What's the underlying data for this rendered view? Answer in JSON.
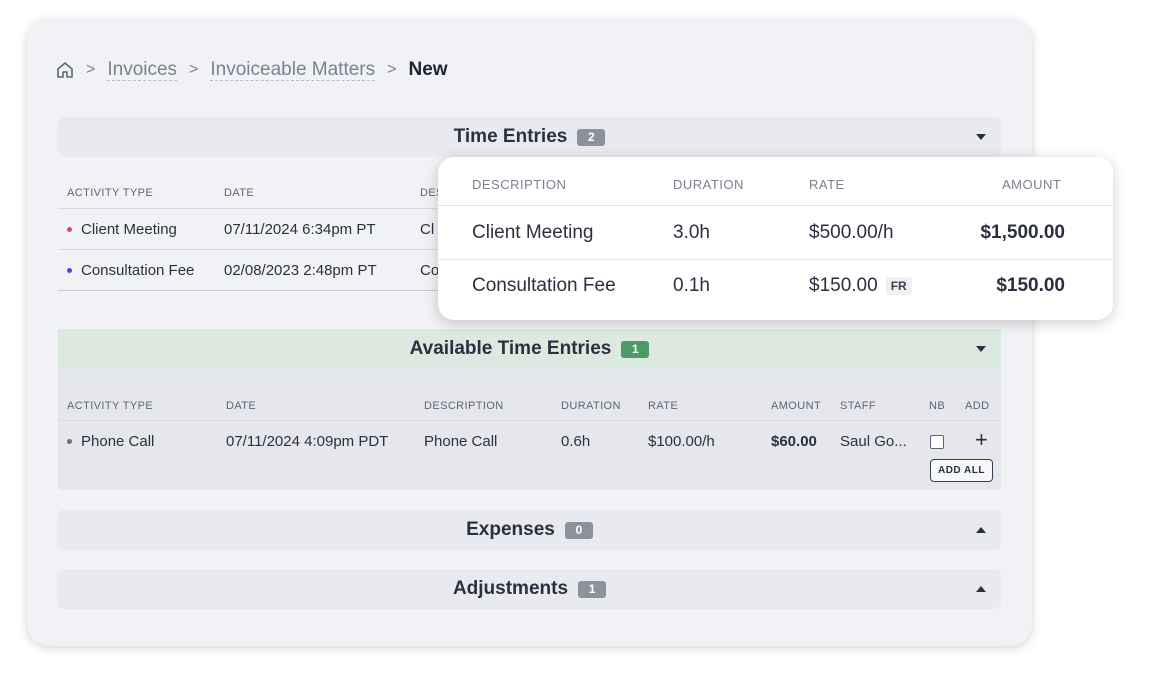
{
  "breadcrumb": {
    "items": [
      "Invoices",
      "Invoiceable Matters"
    ],
    "current": "New"
  },
  "time_entries": {
    "title": "Time Entries",
    "count": "2",
    "columns": [
      "ACTIVITY TYPE",
      "DATE",
      "DES"
    ],
    "rows": [
      {
        "activity": "Client Meeting",
        "date": "07/11/2024 6:34pm PT",
        "desc": "Cl",
        "dot_color": "#e0436b"
      },
      {
        "activity": "Consultation Fee",
        "date": "02/08/2023 2:48pm PT",
        "desc": "Co",
        "dot_color": "#5a3fd6"
      }
    ]
  },
  "popup": {
    "columns": [
      "DESCRIPTION",
      "DURATION",
      "RATE",
      "AMOUNT"
    ],
    "rows": [
      {
        "description": "Client Meeting",
        "duration": "3.0h",
        "rate": "$500.00/h",
        "tag": "",
        "amount": "$1,500.00"
      },
      {
        "description": "Consultation Fee",
        "duration": "0.1h",
        "rate": "$150.00",
        "tag": "FR",
        "amount": "$150.00"
      }
    ]
  },
  "available": {
    "title": "Available Time Entries",
    "count": "1",
    "columns": [
      "ACTIVITY TYPE",
      "DATE",
      "DESCRIPTION",
      "DURATION",
      "RATE",
      "AMOUNT",
      "STAFF",
      "NB",
      "ADD"
    ],
    "rows": [
      {
        "activity": "Phone Call",
        "date": "07/11/2024 4:09pm PDT",
        "description": "Phone Call",
        "duration": "0.6h",
        "rate": "$100.00/h",
        "amount": "$60.00",
        "staff": "Saul Go...",
        "dot_color": "#6b7080"
      }
    ],
    "add_all_label": "ADD ALL",
    "add_symbol": "+"
  },
  "expenses": {
    "title": "Expenses",
    "count": "0"
  },
  "adjustments": {
    "title": "Adjustments",
    "count": "1"
  }
}
